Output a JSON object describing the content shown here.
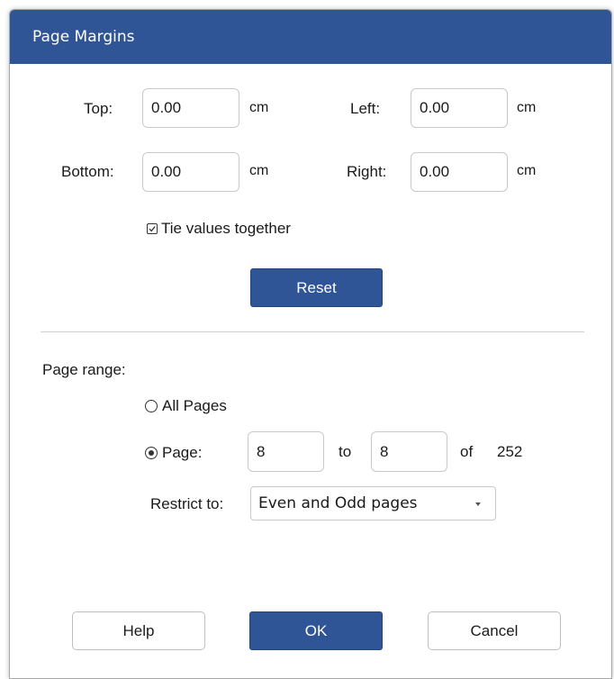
{
  "dialog": {
    "title": "Page Margins"
  },
  "margins": {
    "top_label": "Top:",
    "top_value": "0.00",
    "top_unit": "cm",
    "left_label": "Left:",
    "left_value": "0.00",
    "left_unit": "cm",
    "bottom_label": "Bottom:",
    "bottom_value": "0.00",
    "bottom_unit": "cm",
    "right_label": "Right:",
    "right_value": "0.00",
    "right_unit": "cm",
    "tie_label": "Tie values together",
    "tie_checked": true,
    "reset_label": "Reset"
  },
  "page_range": {
    "heading": "Page range:",
    "all_pages_label": "All Pages",
    "all_pages_selected": false,
    "page_label": "Page:",
    "page_selected": true,
    "from_value": "8",
    "to_label": "to",
    "to_value": "8",
    "of_label": "of",
    "total_pages": "252",
    "restrict_label": "Restrict to:",
    "restrict_value": "Even and Odd pages"
  },
  "footer": {
    "help_label": "Help",
    "ok_label": "OK",
    "cancel_label": "Cancel"
  },
  "colors": {
    "accent": "#2f5597",
    "title_text": "#ffffff"
  }
}
